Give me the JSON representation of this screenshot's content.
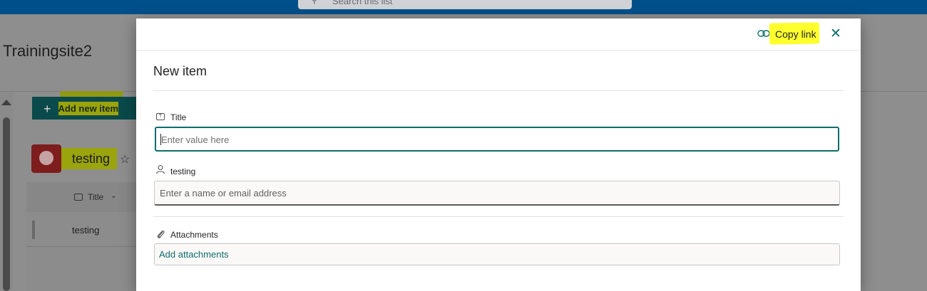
{
  "topbar": {
    "search_placeholder": "Search this list"
  },
  "site": {
    "title": "Trainingsite2"
  },
  "command_bar": {
    "add_new_item_label": "Add new item"
  },
  "list": {
    "name": "testing",
    "column_header": "Title",
    "rows": [
      "testing"
    ]
  },
  "dialog": {
    "copy_link_label": "Copy link",
    "title": "New item",
    "fields": {
      "title": {
        "label": "Title",
        "placeholder": "Enter value here"
      },
      "testing": {
        "label": "testing",
        "placeholder": "Enter a name or email address"
      },
      "attachments": {
        "label": "Attachments",
        "action_label": "Add attachments"
      }
    }
  },
  "colors": {
    "accent_teal": "#0f6c6c",
    "suite_bar": "#004f8a",
    "highlight": "#ffff2e"
  },
  "icons": [
    "search-icon",
    "plus-icon",
    "piggy-bank-icon",
    "star-icon",
    "text-field-icon",
    "chevron-down-icon",
    "link-icon",
    "close-icon",
    "person-icon",
    "paperclip-icon"
  ]
}
